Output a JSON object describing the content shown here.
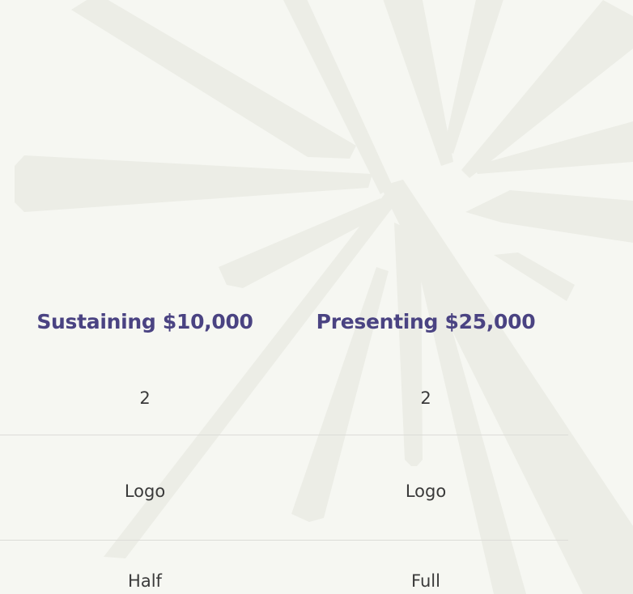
{
  "columns": [
    {
      "label": "Sustaining $10,000"
    },
    {
      "label": "Presenting $25,000"
    }
  ],
  "rows": [
    {
      "values": [
        "2",
        "2"
      ]
    },
    {
      "values": [
        "Logo",
        "Logo"
      ]
    },
    {
      "values": [
        "Half",
        "Full"
      ]
    }
  ],
  "colors": {
    "background": "#f6f7f2",
    "backdrop_shape": "#ecede6",
    "header_text": "#4a4382",
    "cell_text": "#3a3a3a",
    "divider": "#dcdcd8"
  },
  "icons": {
    "backdrop": "starburst-graphic"
  }
}
